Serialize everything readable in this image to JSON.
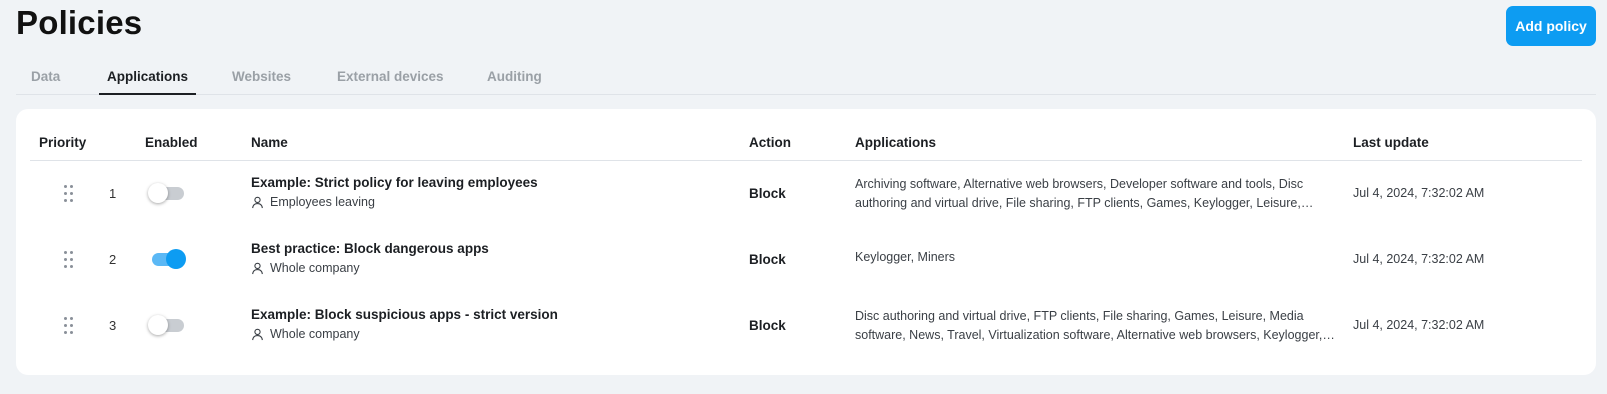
{
  "header": {
    "title": "Policies",
    "add_button_label": "Add policy"
  },
  "tabs": [
    {
      "label": "Data",
      "active": false
    },
    {
      "label": "Applications",
      "active": true
    },
    {
      "label": "Websites",
      "active": false
    },
    {
      "label": "External devices",
      "active": false
    },
    {
      "label": "Auditing",
      "active": false
    }
  ],
  "table": {
    "columns": {
      "priority": "Priority",
      "enabled": "Enabled",
      "name": "Name",
      "action": "Action",
      "applications": "Applications",
      "last_update": "Last update"
    },
    "rows": [
      {
        "priority": "1",
        "enabled": false,
        "name": "Example: Strict policy for leaving employees",
        "scope": "Employees leaving",
        "action": "Block",
        "applications": "Archiving software, Alternative web browsers, Developer software and tools, Disc authoring and virtual drive, File sharing, FTP clients, Games, Keylogger, Leisure, Media software, News, Travel",
        "last_update": "Jul 4, 2024, 7:32:02 AM"
      },
      {
        "priority": "2",
        "enabled": true,
        "name": "Best practice: Block dangerous apps",
        "scope": "Whole company",
        "action": "Block",
        "applications": "Keylogger, Miners",
        "last_update": "Jul 4, 2024, 7:32:02 AM"
      },
      {
        "priority": "3",
        "enabled": false,
        "name": "Example: Block suspicious apps - strict version",
        "scope": "Whole company",
        "action": "Block",
        "applications": "Disc authoring and virtual drive, FTP clients, File sharing, Games, Leisure, Media software, News, Travel, Virtualization software, Alternative web browsers, Keylogger, Miners",
        "last_update": "Jul 4, 2024, 7:32:02 AM"
      }
    ]
  },
  "colors": {
    "accent": "#0d9cf2",
    "background": "#f0f3f6"
  },
  "icons": {
    "drag_handle": "drag-handle-icon",
    "scope": "user-icon"
  }
}
